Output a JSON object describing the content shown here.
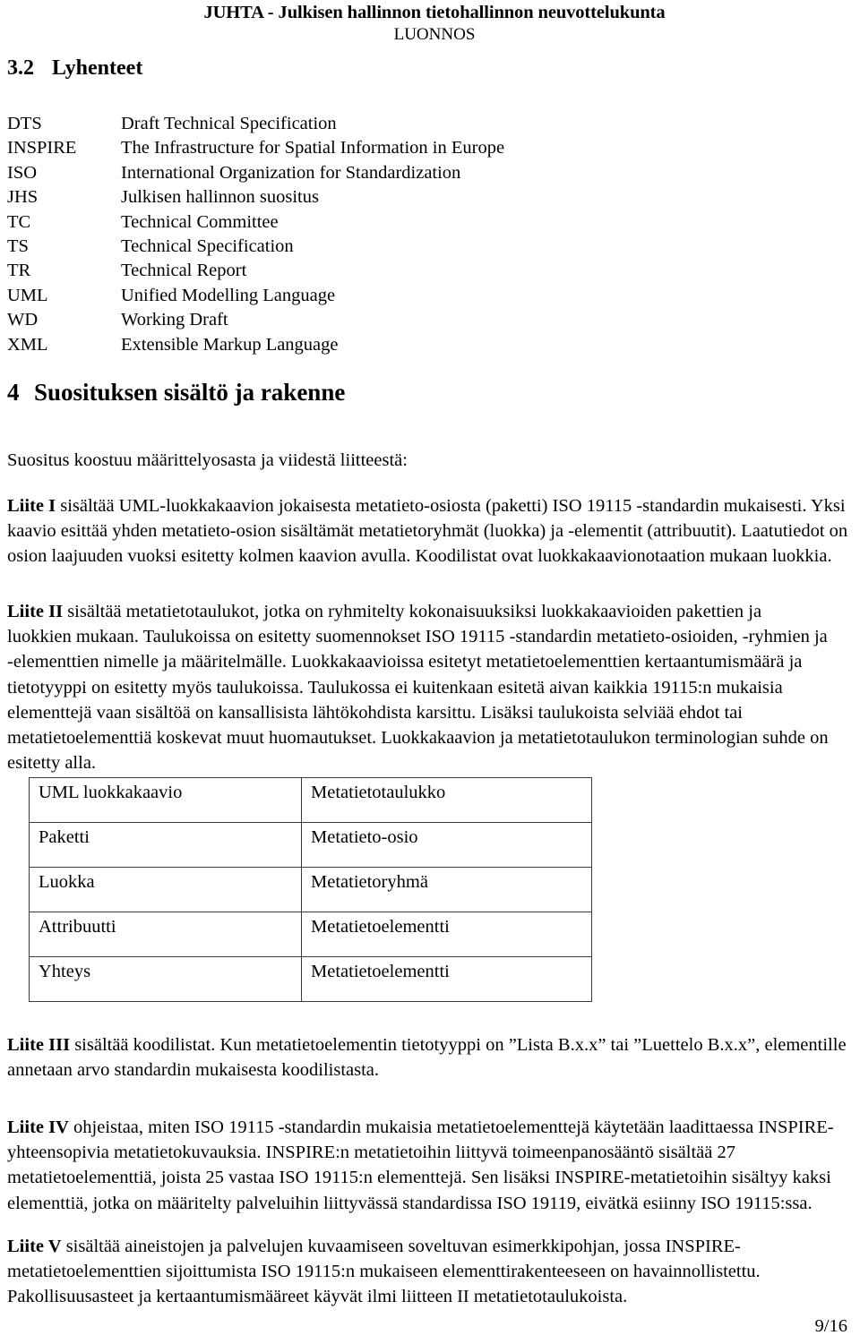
{
  "header": {
    "organization": "JUHTA - Julkisen hallinnon tietohallinnon neuvottelukunta",
    "draft_marker": "LUONNOS"
  },
  "section_abbreviations": {
    "number": "3.2",
    "title": "Lyhenteet",
    "items": [
      {
        "term": "DTS",
        "definition": "Draft Technical Specification"
      },
      {
        "term": "INSPIRE",
        "definition": "The Infrastructure for Spatial Information in Europe"
      },
      {
        "term": "ISO",
        "definition": "International Organization for Standardization"
      },
      {
        "term": "JHS",
        "definition": "Julkisen hallinnon suositus"
      },
      {
        "term": "TC",
        "definition": "Technical Committee"
      },
      {
        "term": "TS",
        "definition": "Technical Specification"
      },
      {
        "term": "TR",
        "definition": "Technical Report"
      },
      {
        "term": "UML",
        "definition": "Unified Modelling Language"
      },
      {
        "term": "WD",
        "definition": "Working Draft"
      },
      {
        "term": "XML",
        "definition": "Extensible Markup Language"
      }
    ]
  },
  "section_content": {
    "number": "4",
    "title": "Suosituksen sisältö ja rakenne",
    "intro": "Suositus koostuu määrittelyosasta ja viidestä liitteestä:",
    "liite1": {
      "label": "Liite I",
      "body": " sisältää UML-luokkakaavion jokaisesta metatieto-osiosta (paketti) ISO 19115 -standardin mukaisesti. Yksi kaavio esittää yhden metatieto-osion sisältämät metatietoryhmät (luokka) ja -elementit (attribuutit). Laatutiedot on osion laajuuden vuoksi esitetty kolmen kaavion avulla. Koodilistat ovat luokkakaavionotaation mukaan luokkia."
    },
    "liite2": {
      "label": "Liite II",
      "body": " sisältää metatietotaulukot, jotka on ryhmitelty kokonaisuuksiksi luokkakaavioiden pakettien ja luokkien mukaan. Taulukoissa on esitetty suomennokset ISO 19115 -standardin metatieto-osioiden, -ryhmien ja -elementtien nimelle ja määritelmälle. Luokkakaavioissa esitetyt metatietoelementtien kertaantumismäärä ja tietotyyppi on esitetty myös taulukoissa. Taulukossa ei kuitenkaan esitetä aivan kaikkia 19115:n mukaisia elementtejä vaan sisältöä on kansallisista lähtökohdista karsittu. Lisäksi taulukoista selviää ehdot tai metatietoelementtiä koskevat muut huomautukset. Luokkakaavion ja metatietotaulukon terminologian suhde on esitetty alla."
    },
    "liite3": {
      "label": "Liite III",
      "body": " sisältää koodilistat. Kun metatietoelementin tietotyyppi on ”Lista B.x.x” tai ”Luettelo B.x.x”, elementille annetaan arvo standardin mukaisesta koodilistasta."
    },
    "liite4": {
      "label": "Liite IV",
      "body": " ohjeistaa, miten ISO 19115 -standardin mukaisia metatietoelementtejä käytetään laadittaessa INSPIRE-yhteensopivia metatietokuvauksia. INSPIRE:n metatietoihin liittyvä toimeenpanosääntö sisältää 27 metatietoelementtiä, joista 25 vastaa ISO 19115:n elementtejä. Sen lisäksi INSPIRE-metatietoihin sisältyy kaksi elementtiä, jotka on määritelty palveluihin liittyvässä standardissa ISO 19119, eivätkä esiinny ISO 19115:ssa."
    },
    "liite5": {
      "label": "Liite V",
      "body": " sisältää aineistojen ja palvelujen kuvaamiseen soveltuvan esimerkkipohjan, jossa INSPIRE-metatietoelementtien sijoittumista ISO 19115:n mukaiseen elementtirakenteeseen on havainnollistettu. Pakollisuusasteet ja kertaantumismääreet käyvät ilmi liitteen II metatietotaulukoista."
    }
  },
  "terminology_table": {
    "rows": [
      {
        "uml": "UML luokkakaavio",
        "metadata": "Metatietotaulukko"
      },
      {
        "uml": "Paketti",
        "metadata": "Metatieto-osio"
      },
      {
        "uml": "Luokka",
        "metadata": "Metatietoryhmä"
      },
      {
        "uml": "Attribuutti",
        "metadata": "Metatietoelementti"
      },
      {
        "uml": "Yhteys",
        "metadata": "Metatietoelementti"
      }
    ]
  },
  "footer": {
    "page_number": "9/16"
  }
}
